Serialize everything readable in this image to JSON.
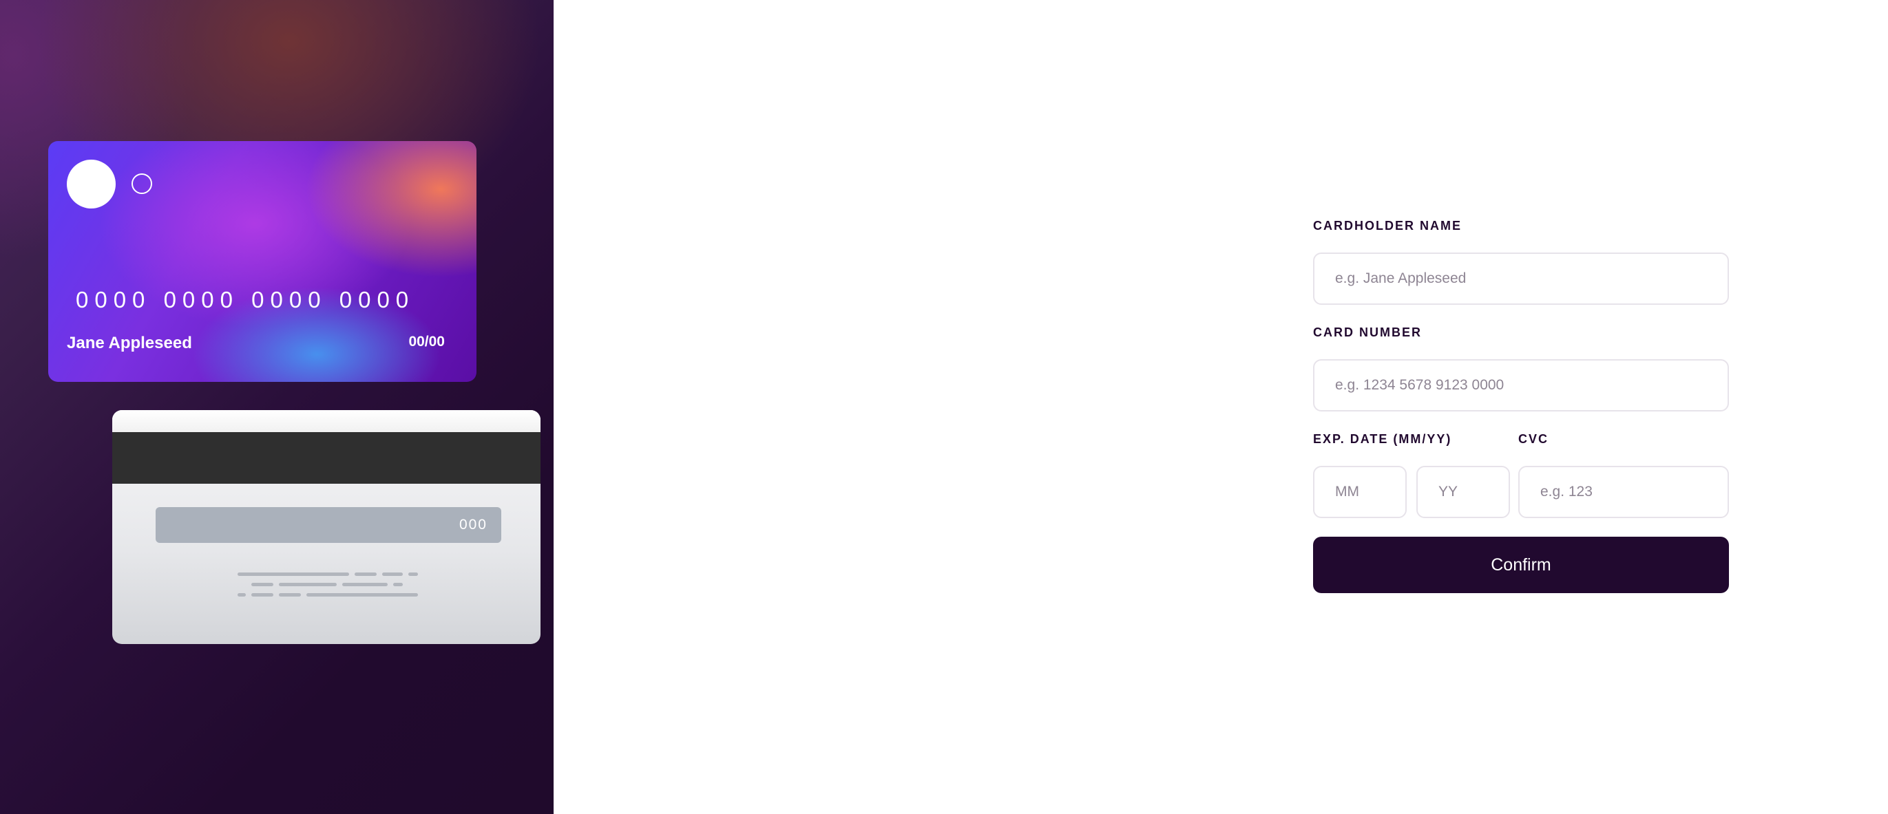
{
  "card_front": {
    "number": "0000 0000 0000 0000",
    "name": "Jane Appleseed",
    "expiry": "00/00"
  },
  "card_back": {
    "cvc": "000"
  },
  "form": {
    "cardholder_name": {
      "label": "CARDHOLDER NAME",
      "placeholder": "e.g. Jane Appleseed",
      "value": ""
    },
    "card_number": {
      "label": "CARD NUMBER",
      "placeholder": "e.g. 1234 5678 9123 0000",
      "value": ""
    },
    "expiry": {
      "label": "EXP. DATE (MM/YY)",
      "month_placeholder": "MM",
      "year_placeholder": "YY"
    },
    "cvc": {
      "label": "CVC",
      "placeholder": "e.g. 123",
      "value": ""
    },
    "confirm_label": "Confirm"
  },
  "colors": {
    "dark_violet": "#21092f",
    "input_border": "#e7e3ea",
    "placeholder": "#8e8593"
  }
}
